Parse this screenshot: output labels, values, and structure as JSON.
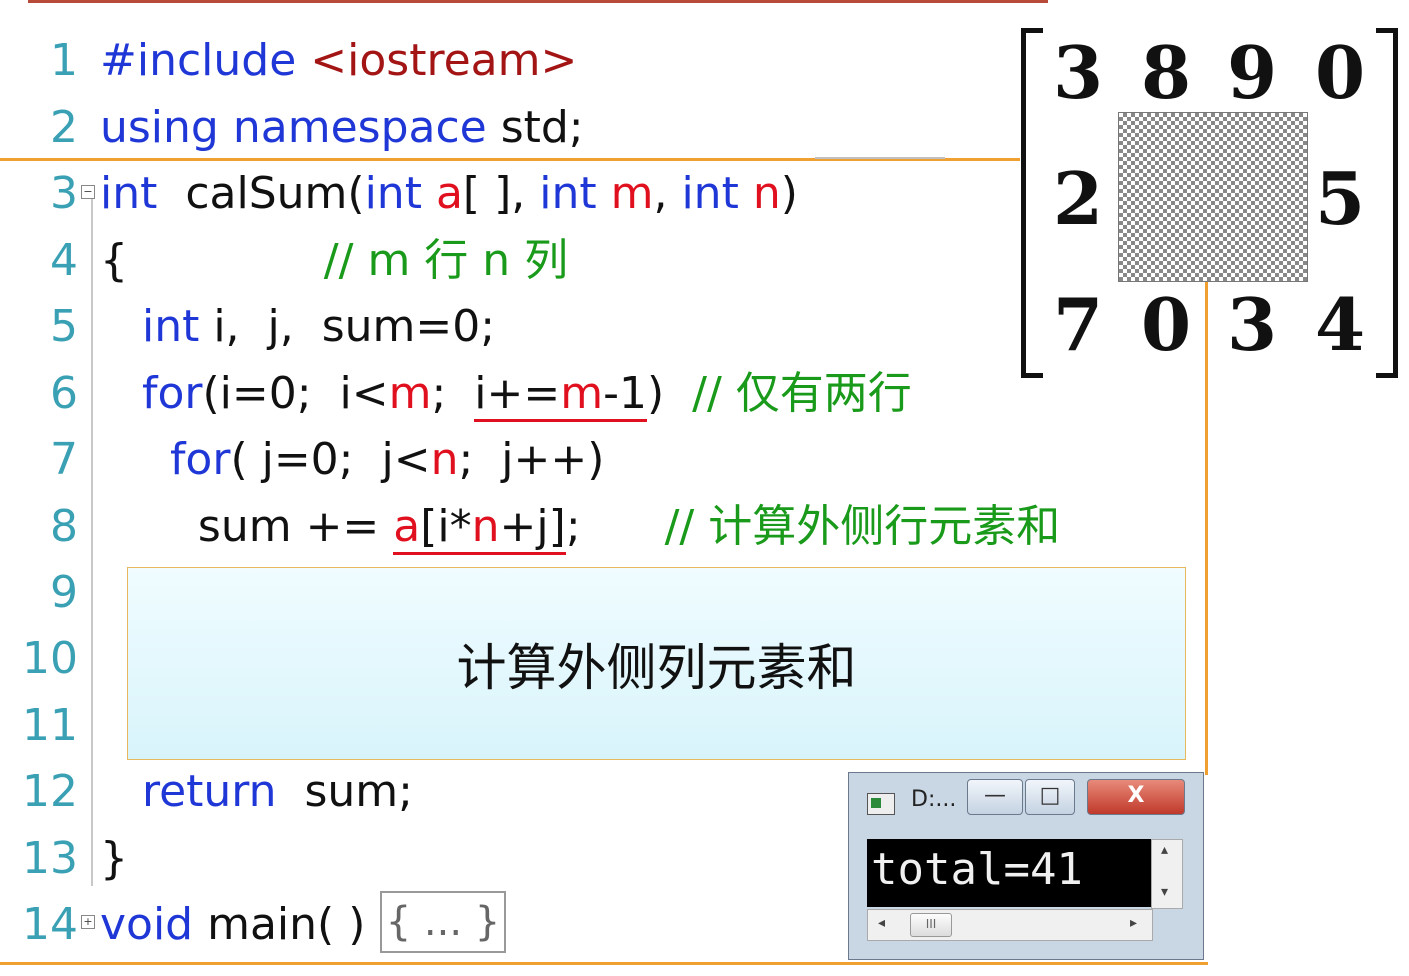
{
  "code": {
    "lines": [
      {
        "n": "1",
        "tokens": [
          {
            "t": "#include",
            "c": "pp"
          },
          {
            "t": " ",
            "c": "txt"
          },
          {
            "t": "<iostream>",
            "c": "str"
          }
        ]
      },
      {
        "n": "2",
        "tokens": [
          {
            "t": "using",
            "c": "kw"
          },
          {
            "t": " ",
            "c": "txt"
          },
          {
            "t": "namespace",
            "c": "kw"
          },
          {
            "t": " std;",
            "c": "txt"
          }
        ]
      },
      {
        "n": "3",
        "tokens": [
          {
            "t": "int",
            "c": "kw"
          },
          {
            "t": "  calSum(",
            "c": "txt"
          },
          {
            "t": "int",
            "c": "kw"
          },
          {
            "t": " ",
            "c": "txt"
          },
          {
            "t": "a",
            "c": "var"
          },
          {
            "t": "[ ], ",
            "c": "txt"
          },
          {
            "t": "int",
            "c": "kw"
          },
          {
            "t": " ",
            "c": "txt"
          },
          {
            "t": "m",
            "c": "var"
          },
          {
            "t": ", ",
            "c": "txt"
          },
          {
            "t": "int",
            "c": "kw"
          },
          {
            "t": " ",
            "c": "txt"
          },
          {
            "t": "n",
            "c": "var"
          },
          {
            "t": ")",
            "c": "txt"
          }
        ]
      },
      {
        "n": "4",
        "tokens": [
          {
            "t": "{",
            "c": "txt"
          },
          {
            "t": "              // m 行 n 列",
            "c": "cm"
          }
        ]
      },
      {
        "n": "5",
        "tokens": [
          {
            "t": "   ",
            "c": "txt"
          },
          {
            "t": "int",
            "c": "kw"
          },
          {
            "t": " i,  j,  sum=0;",
            "c": "txt"
          }
        ]
      },
      {
        "n": "6",
        "tokens": [
          {
            "t": "   ",
            "c": "txt"
          },
          {
            "t": "for",
            "c": "kw"
          },
          {
            "t": "(i=0;  i<",
            "c": "txt"
          },
          {
            "t": "m",
            "c": "var"
          },
          {
            "t": ";  ",
            "c": "txt"
          },
          {
            "t": "i+=",
            "c": "txt",
            "u": true
          },
          {
            "t": "m",
            "c": "var",
            "u": true
          },
          {
            "t": "-1",
            "c": "txt",
            "u": true
          },
          {
            "t": ")  ",
            "c": "txt"
          },
          {
            "t": "// 仅有两行",
            "c": "cm"
          }
        ]
      },
      {
        "n": "7",
        "tokens": [
          {
            "t": "     ",
            "c": "txt"
          },
          {
            "t": "for",
            "c": "kw"
          },
          {
            "t": "( j=0;  j<",
            "c": "txt"
          },
          {
            "t": "n",
            "c": "var"
          },
          {
            "t": ";  j++)",
            "c": "txt"
          }
        ]
      },
      {
        "n": "8",
        "tokens": [
          {
            "t": "       sum += ",
            "c": "txt"
          },
          {
            "t": "a",
            "c": "var",
            "u": true
          },
          {
            "t": "[i*",
            "c": "txt",
            "u": true
          },
          {
            "t": "n",
            "c": "var",
            "u": true
          },
          {
            "t": "+j]",
            "c": "txt",
            "u": true
          },
          {
            "t": ";      ",
            "c": "txt"
          },
          {
            "t": "// 计算外侧行元素和",
            "c": "cm"
          }
        ]
      },
      {
        "n": "9",
        "tokens": []
      },
      {
        "n": "10",
        "tokens": []
      },
      {
        "n": "11",
        "tokens": []
      },
      {
        "n": "12",
        "tokens": [
          {
            "t": "   ",
            "c": "txt"
          },
          {
            "t": "return",
            "c": "kw"
          },
          {
            "t": "  sum;",
            "c": "txt"
          }
        ]
      },
      {
        "n": "13",
        "tokens": [
          {
            "t": "}",
            "c": "txt"
          }
        ]
      },
      {
        "n": "14",
        "tokens": [
          {
            "t": "void",
            "c": "kw"
          },
          {
            "t": " main( )",
            "c": "txt"
          }
        ]
      }
    ],
    "collapsed_body": "{ ... }"
  },
  "hint": {
    "text": "计算外侧列元素和"
  },
  "matrix": {
    "rows": [
      [
        "3",
        "8",
        "9",
        "0"
      ],
      [
        "2",
        "",
        "",
        "5"
      ],
      [
        "7",
        "0",
        "3",
        "4"
      ]
    ]
  },
  "console": {
    "title": "D:...",
    "output": "total=41",
    "minimize": "—",
    "maximize": "□",
    "close": "X"
  }
}
